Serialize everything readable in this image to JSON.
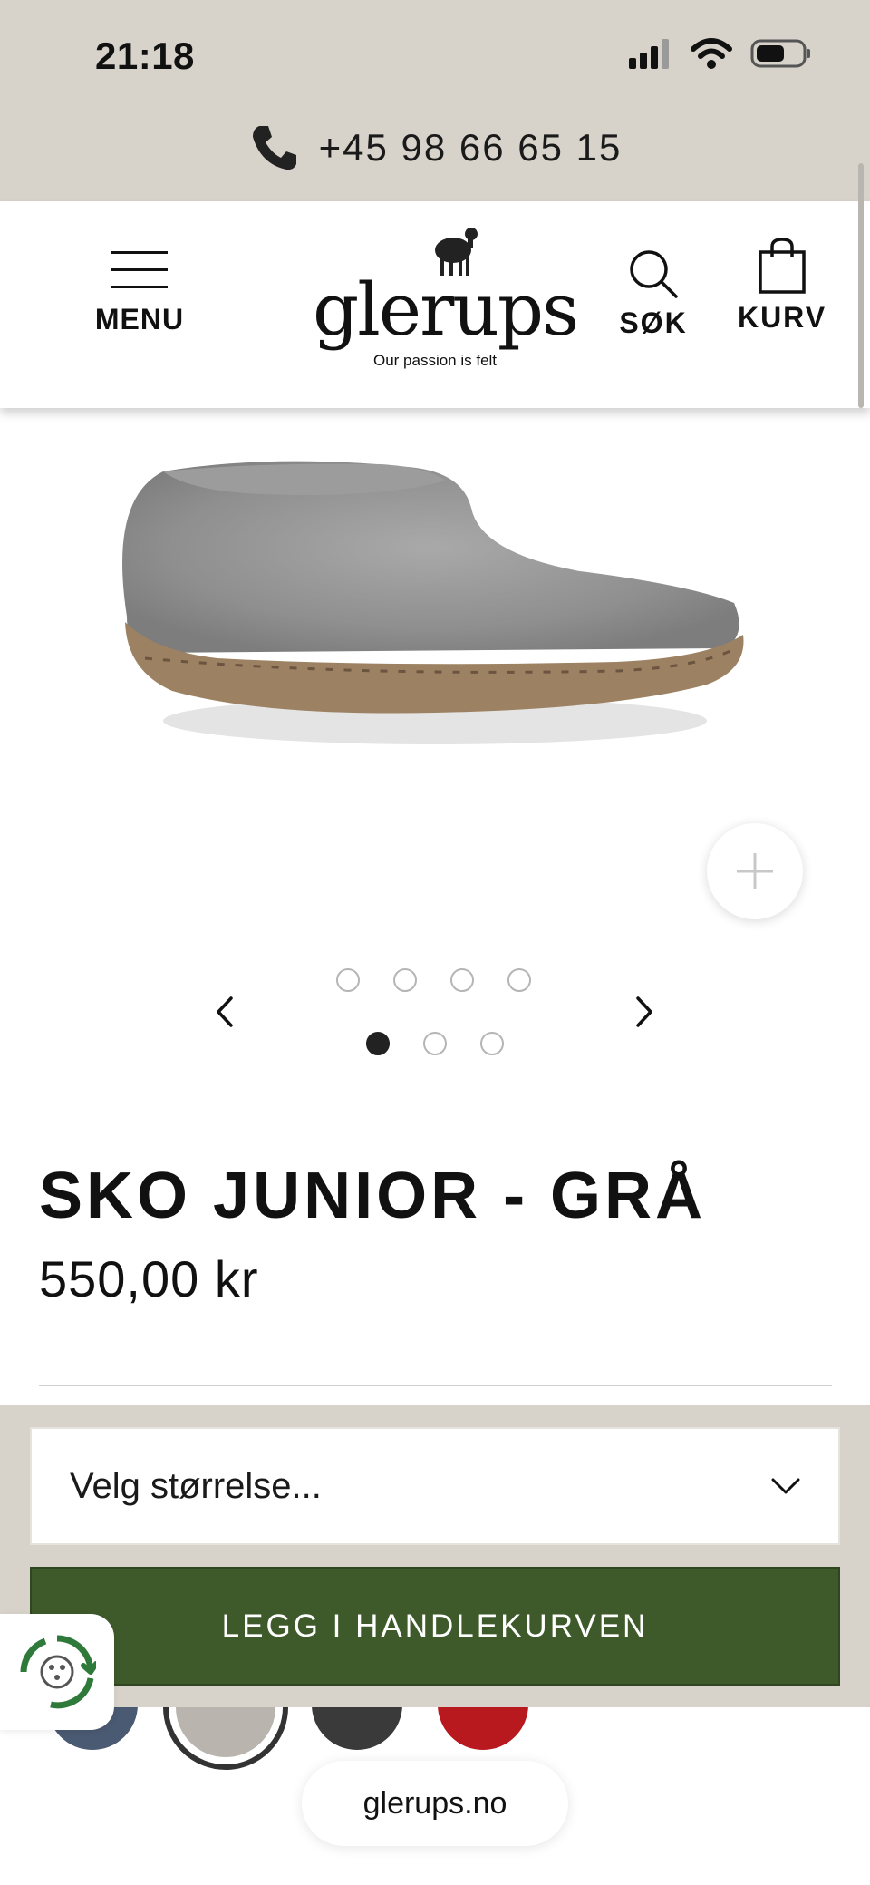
{
  "status_bar": {
    "time": "21:18"
  },
  "contact": {
    "phone": "+45 98 66 65 15"
  },
  "header": {
    "menu_label": "MENU",
    "logo_text": "glerups",
    "logo_tagline": "Our passion is felt",
    "search_label": "SØK",
    "cart_label": "KURV"
  },
  "gallery": {
    "image_icon": "felt-shoe-image",
    "thumbnail_dots": 4,
    "slide_dots": 3,
    "active_slide": 1
  },
  "product": {
    "title": "SKO JUNIOR - GRÅ",
    "price": "550,00 kr"
  },
  "swatches": {
    "colors": [
      "#4a5a72",
      "#b9b4ae",
      "#3a3a3a",
      "#b8191f"
    ],
    "selected_index": 1
  },
  "purchase": {
    "size_placeholder": "Velg størrelse...",
    "add_to_cart": "LEGG I HANDLEKURVEN"
  },
  "browser": {
    "url": "glerups.no"
  },
  "colors": {
    "band": "#d8d3ca",
    "cta_green": "#3e5a2a",
    "badge_green": "#2f7a3a"
  }
}
